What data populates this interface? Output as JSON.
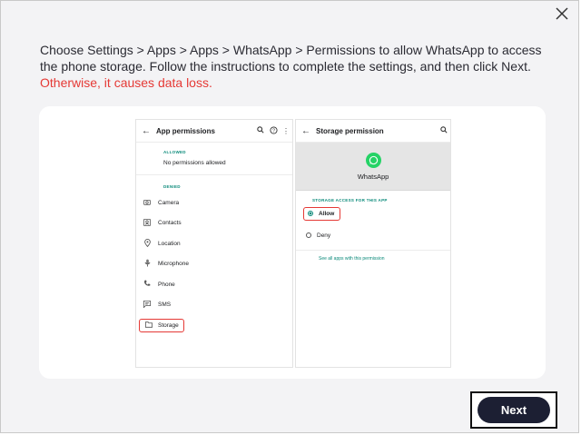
{
  "dialog": {
    "close_icon": "close-icon",
    "instruction_text": "Choose Settings > Apps  > Apps  > WhatsApp > Permissions to allow WhatsApp to access the phone storage. Follow the instructions to complete the settings, and then click Next.",
    "warning_text": "Otherwise, it causes data loss.",
    "warning_color": "#e53935",
    "next_label": "Next"
  },
  "left_phone": {
    "title": "App permissions",
    "icons": [
      "back-arrow-icon",
      "search-icon",
      "help-icon",
      "more-vert-icon"
    ],
    "allowed_label": "ALLOWED",
    "no_permissions": "No permissions allowed",
    "denied_label": "DENIED",
    "items": [
      {
        "label": "Camera",
        "icon": "camera-icon"
      },
      {
        "label": "Contacts",
        "icon": "contacts-icon"
      },
      {
        "label": "Location",
        "icon": "location-icon"
      },
      {
        "label": "Microphone",
        "icon": "microphone-icon"
      },
      {
        "label": "Phone",
        "icon": "phone-icon"
      },
      {
        "label": "SMS",
        "icon": "sms-icon"
      },
      {
        "label": "Storage",
        "icon": "folder-icon"
      }
    ]
  },
  "right_phone": {
    "title": "Storage permission",
    "app_name": "WhatsApp",
    "section_label": "STORAGE ACCESS FOR THIS APP",
    "option_allow": "Allow",
    "option_deny": "Deny",
    "selected": "Allow",
    "link": "See all apps with this permission",
    "accent_color": "#0b8a7a"
  }
}
